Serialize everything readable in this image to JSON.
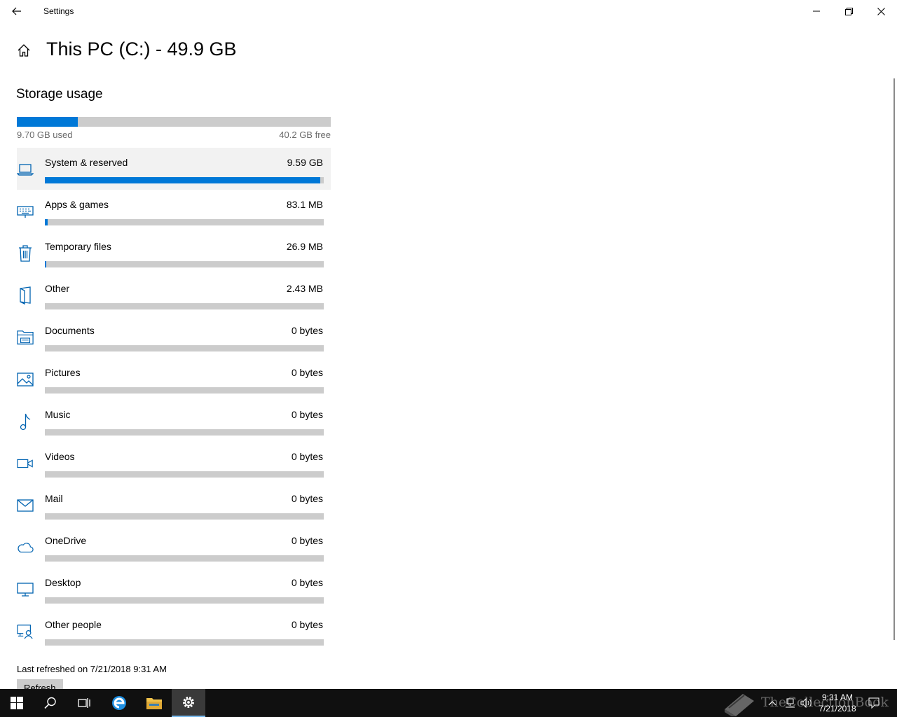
{
  "window": {
    "title": "Settings",
    "controls": {
      "minimize": "minimize-icon",
      "restore": "restore-icon",
      "close": "close-icon"
    }
  },
  "page": {
    "title": "This PC (C:) - 49.9 GB",
    "section_title": "Storage usage",
    "used_label": "9.70 GB used",
    "free_label": "40.2 GB free",
    "used_fraction": 0.194
  },
  "categories": [
    {
      "name": "System & reserved",
      "size": "9.59 GB",
      "fraction": 0.988,
      "icon": "laptop-icon",
      "selected": true
    },
    {
      "name": "Apps & games",
      "size": "83.1 MB",
      "fraction": 0.009,
      "icon": "keyboard-icon"
    },
    {
      "name": "Temporary files",
      "size": "26.9 MB",
      "fraction": 0.003,
      "icon": "trash-icon"
    },
    {
      "name": "Other",
      "size": "2.43 MB",
      "fraction": 0.0,
      "icon": "other-files-icon"
    },
    {
      "name": "Documents",
      "size": "0 bytes",
      "fraction": 0,
      "icon": "documents-icon"
    },
    {
      "name": "Pictures",
      "size": "0 bytes",
      "fraction": 0,
      "icon": "pictures-icon"
    },
    {
      "name": "Music",
      "size": "0 bytes",
      "fraction": 0,
      "icon": "music-icon"
    },
    {
      "name": "Videos",
      "size": "0 bytes",
      "fraction": 0,
      "icon": "videos-icon"
    },
    {
      "name": "Mail",
      "size": "0 bytes",
      "fraction": 0,
      "icon": "mail-icon"
    },
    {
      "name": "OneDrive",
      "size": "0 bytes",
      "fraction": 0,
      "icon": "cloud-icon"
    },
    {
      "name": "Desktop",
      "size": "0 bytes",
      "fraction": 0,
      "icon": "desktop-icon"
    },
    {
      "name": "Other people",
      "size": "0 bytes",
      "fraction": 0,
      "icon": "other-people-icon"
    }
  ],
  "footer": {
    "last_refreshed": "Last refreshed on 7/21/2018 9:31 AM",
    "refresh_label": "Refresh"
  },
  "taskbar": {
    "time": "9:31 AM",
    "date": "7/21/2018",
    "watermark": "TheCollectionBook",
    "accent": "#0078d7"
  }
}
